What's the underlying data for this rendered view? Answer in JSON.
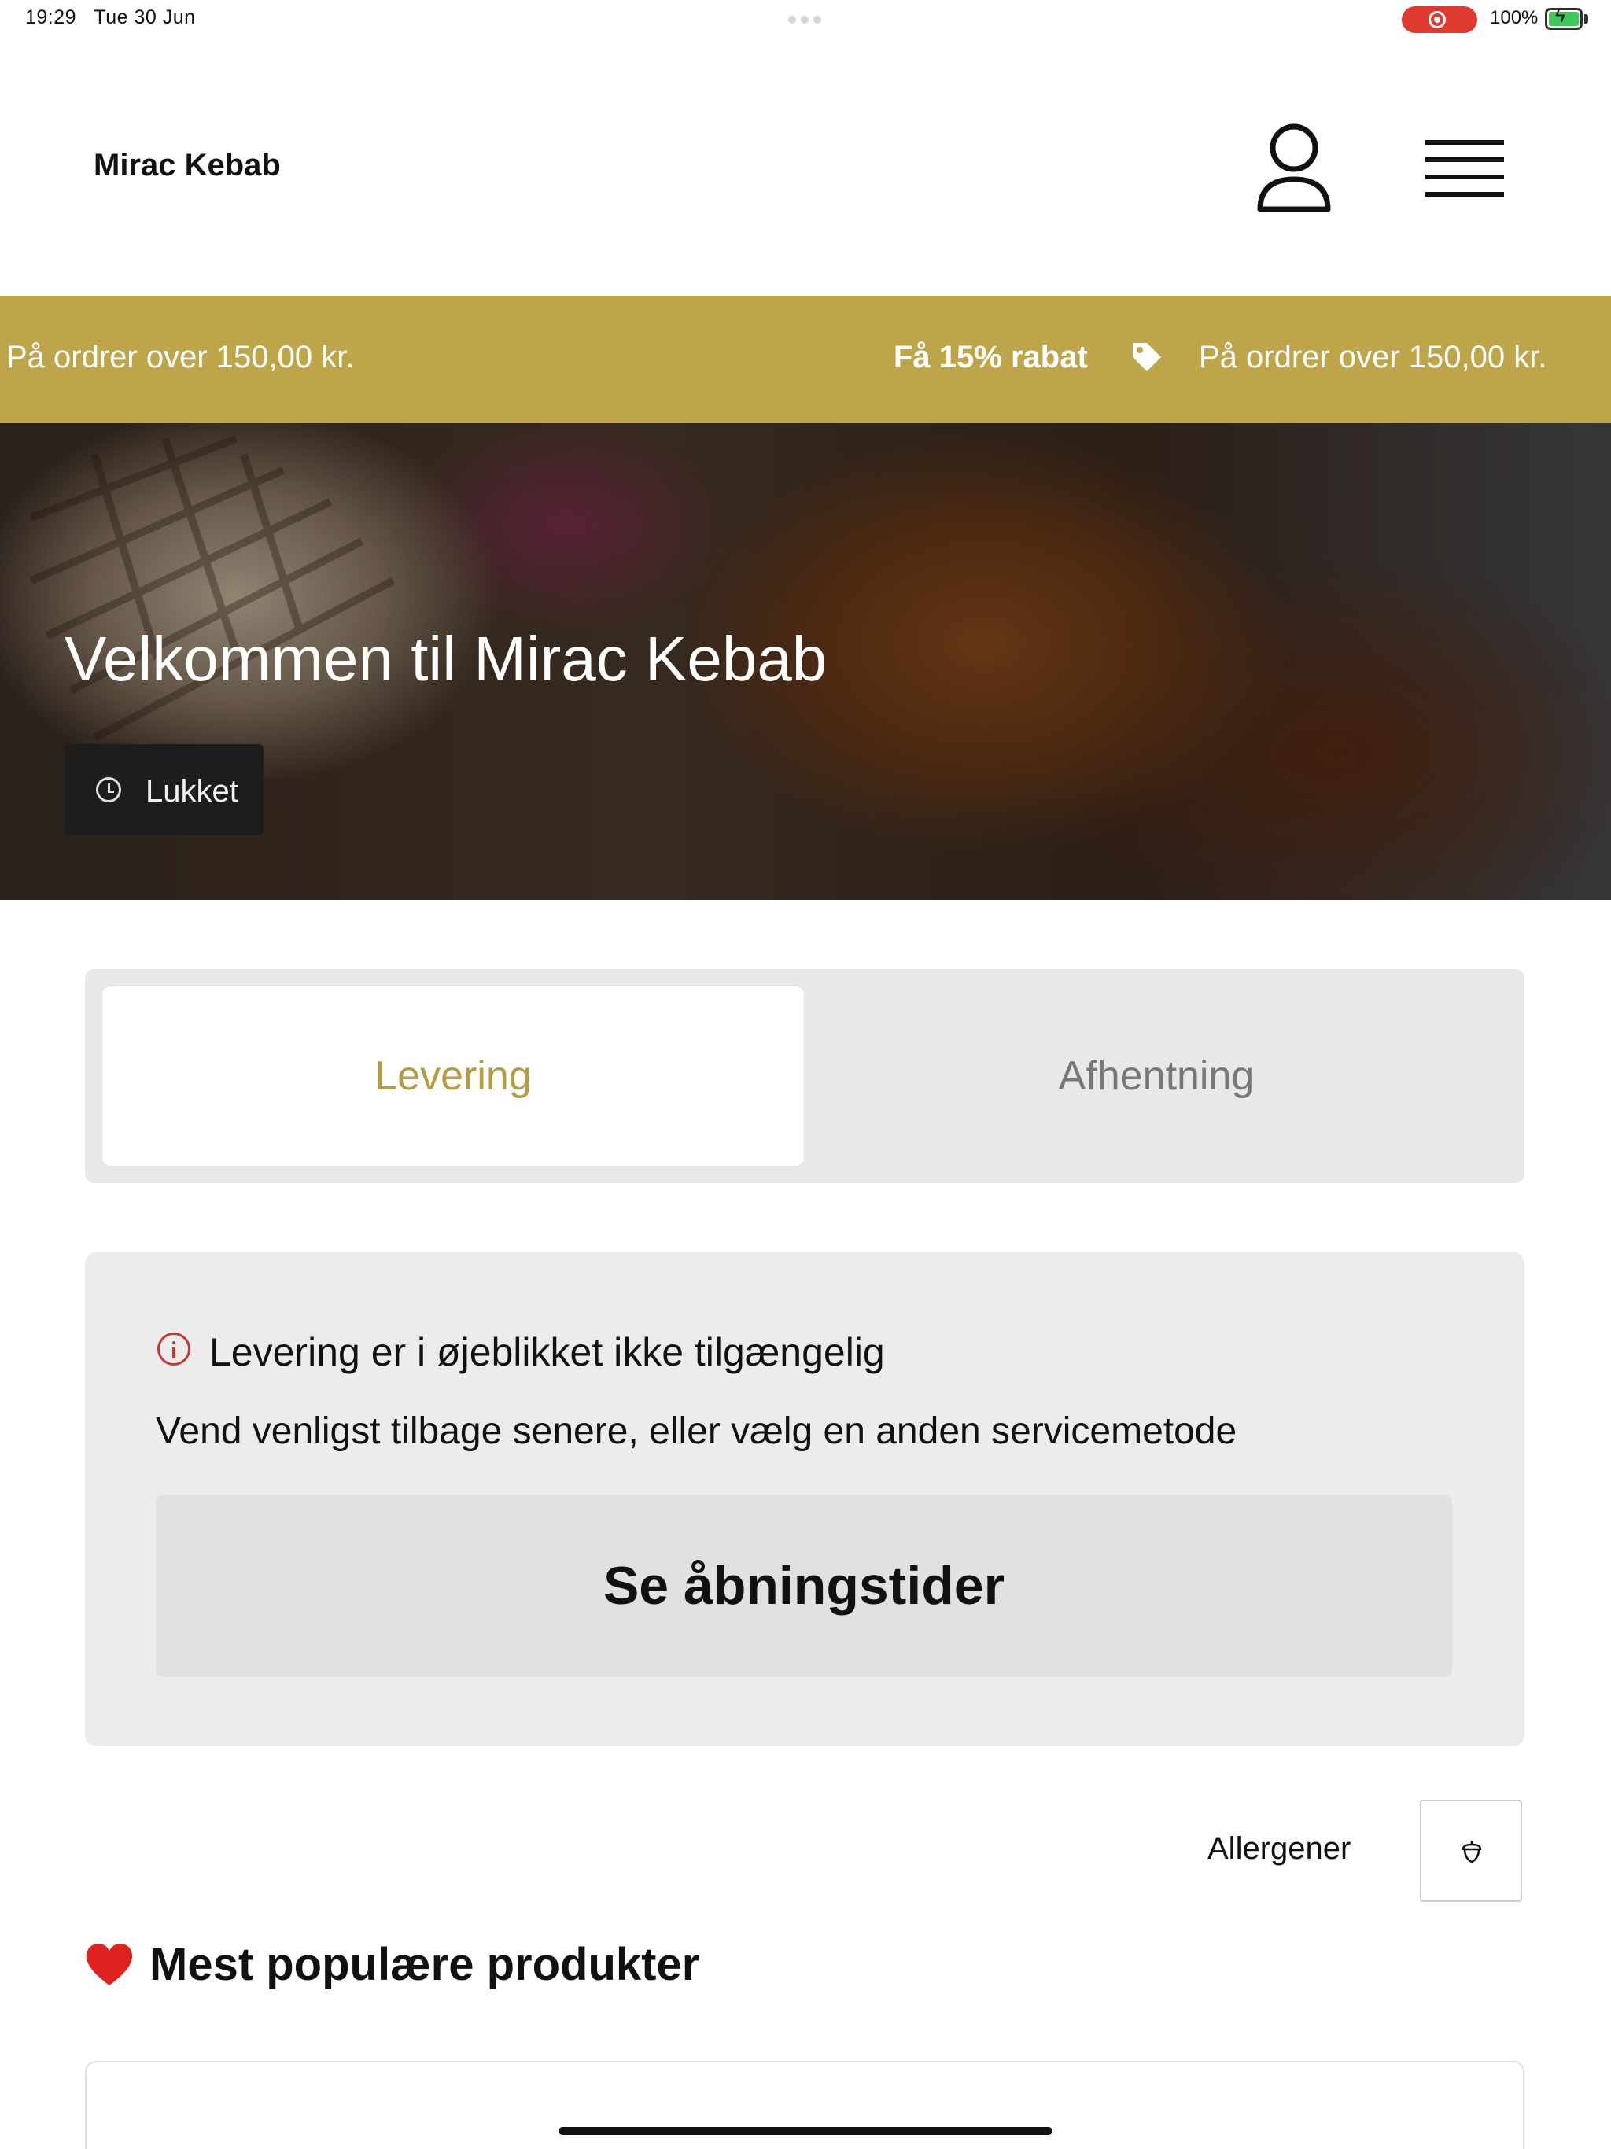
{
  "status_bar": {
    "time": "19:29",
    "date": "Tue 30 Jun",
    "battery": "100%",
    "record_color": "#e0392f"
  },
  "header": {
    "brand": "Mirac Kebab",
    "user_icon": "user-icon",
    "menu_icon": "hamburger-menu-icon"
  },
  "promo": {
    "left_text": "På ordrer over 150,00 kr.",
    "highlight": "Få 15% rabat",
    "right_text": "På ordrer over 150,00 kr.",
    "tag_icon": "tag-icon",
    "background": "#bea54a"
  },
  "hero": {
    "title": "Velkommen til Mirac Kebab",
    "status": "Lukket",
    "status_icon": "clock-icon"
  },
  "service": {
    "options": [
      "Levering",
      "Afhentning"
    ],
    "selected": "Levering",
    "accent": "#b59c40"
  },
  "notice": {
    "icon": "info-icon",
    "title": "Levering er i øjeblikket ikke tilgængelig",
    "body": "Vend venligst tilbage senere, eller vælg en anden servicemetode",
    "button": "Se åbningstider"
  },
  "allergens": {
    "label": "Allergener",
    "icon": "acorn-icon"
  },
  "popular": {
    "heading": "Mest populære produkter",
    "icon": "heart-icon"
  }
}
